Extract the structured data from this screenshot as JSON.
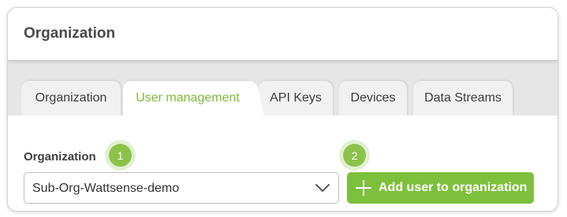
{
  "card": {
    "title": "Organization"
  },
  "tabs": [
    {
      "label": "Organization",
      "active": false
    },
    {
      "label": "User management",
      "active": true
    },
    {
      "label": "API Keys",
      "active": false
    },
    {
      "label": "Devices",
      "active": false
    },
    {
      "label": "Data Streams",
      "active": false
    }
  ],
  "form": {
    "organization_label": "Organization",
    "organization_value": "Sub-Org-Wattsense-demo",
    "add_button_label": "Add user to organization"
  },
  "badges": {
    "first": "1",
    "second": "2"
  },
  "colors": {
    "accent": "#7dba3b",
    "button": "#7dc03b",
    "badge": "#8bc34a"
  },
  "icons": {
    "select": "chevron-down-icon",
    "button": "plus-icon"
  }
}
